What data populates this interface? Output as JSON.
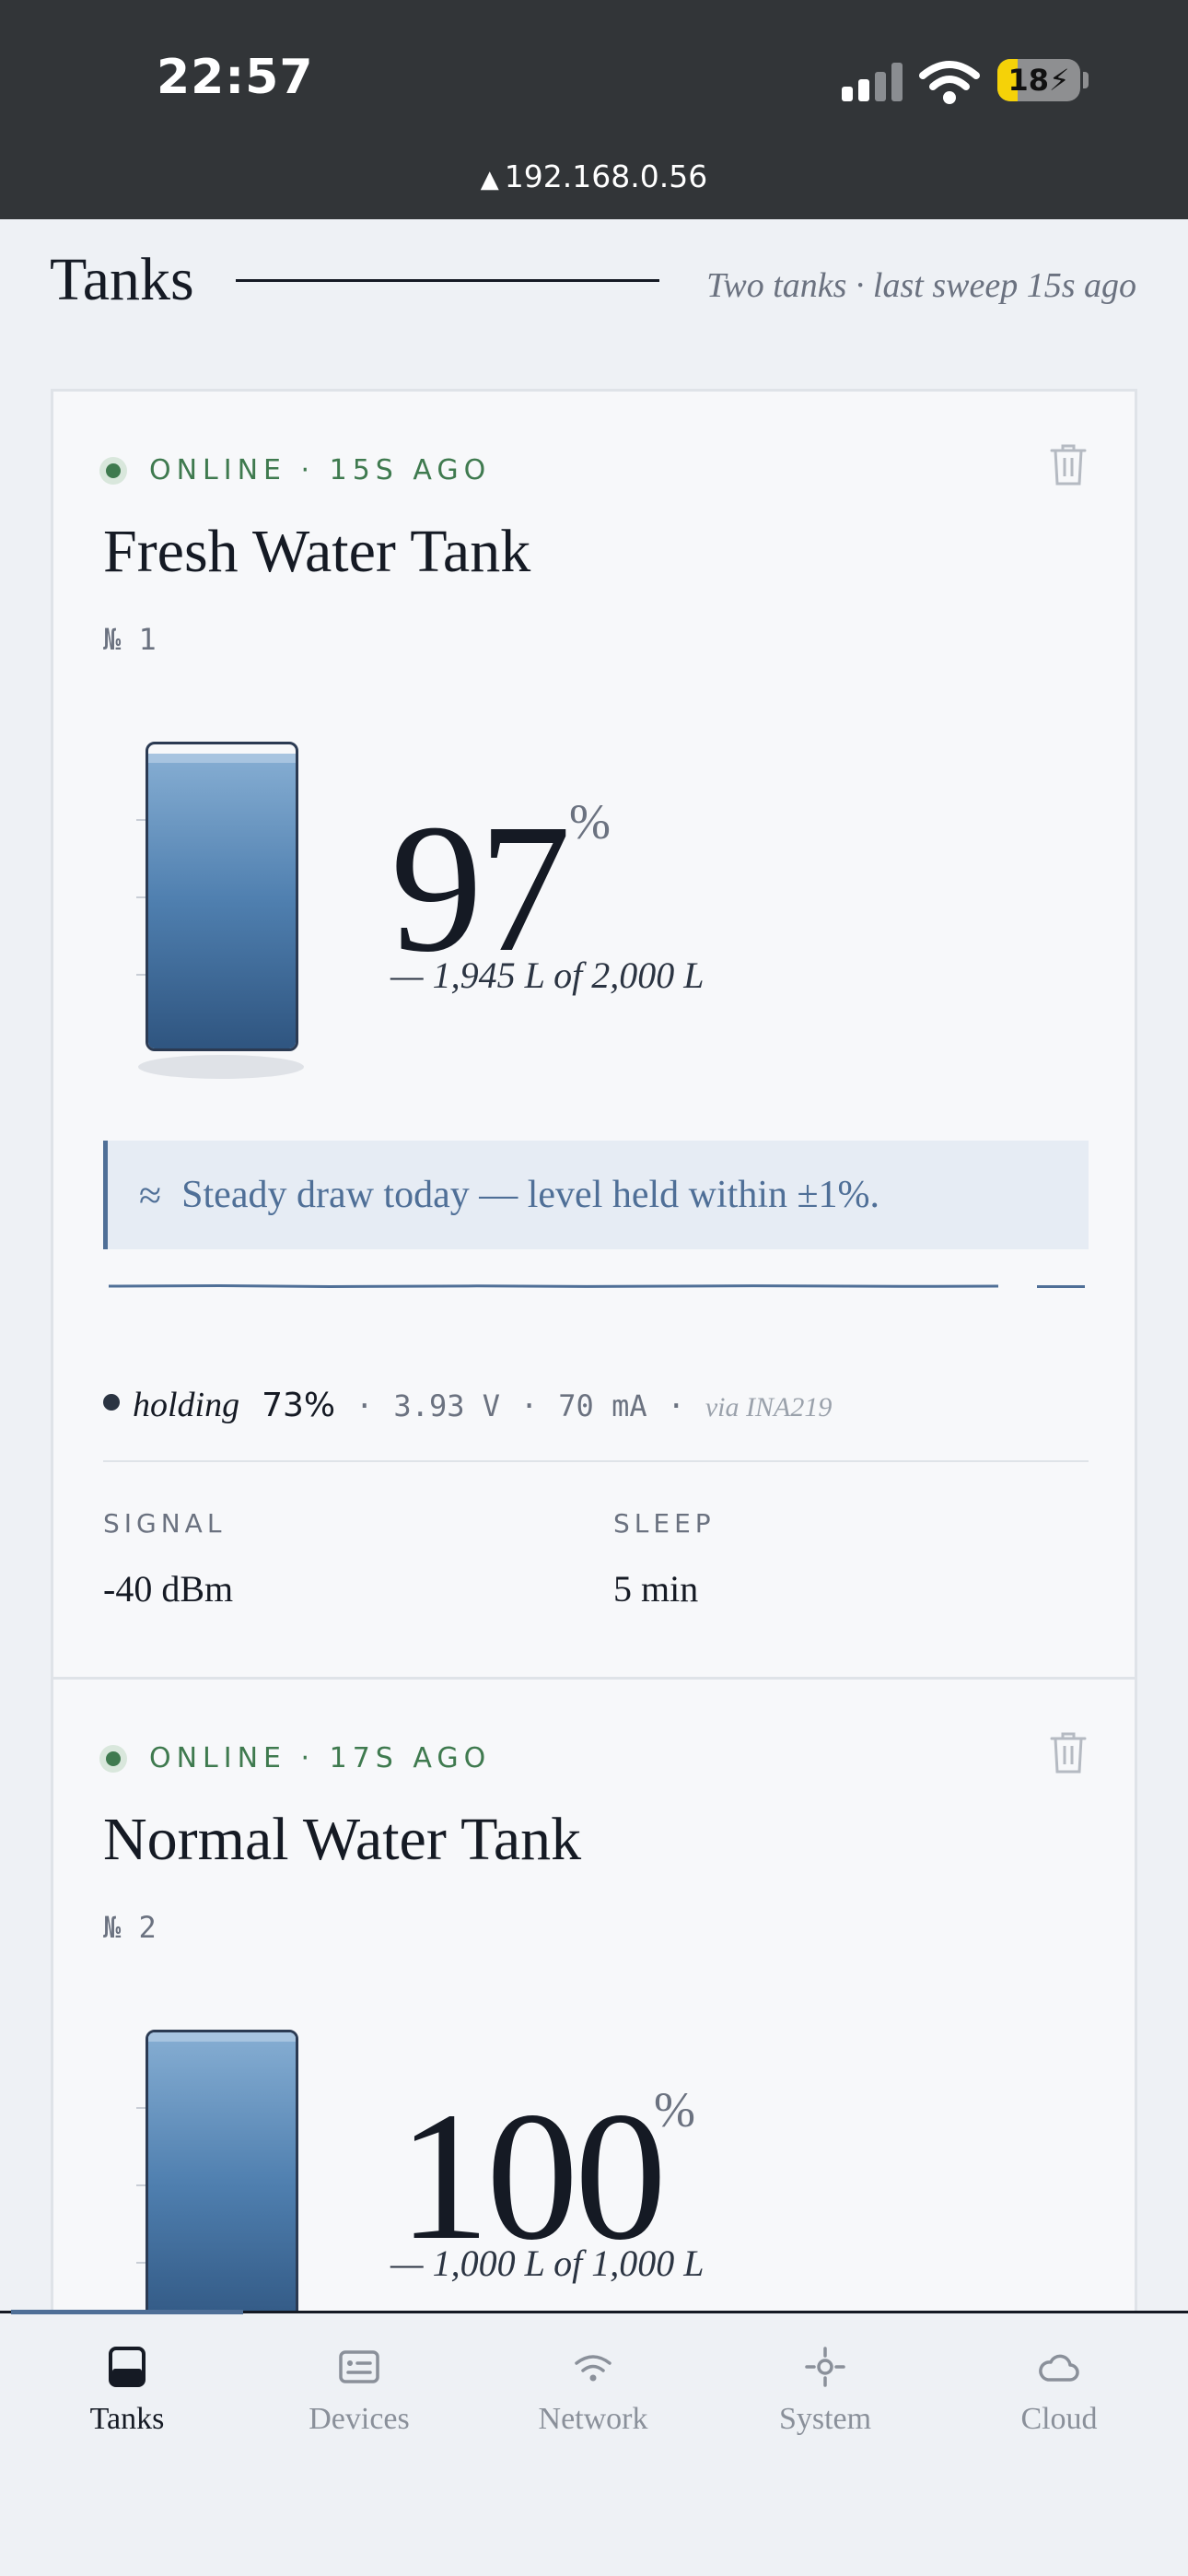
{
  "status_bar": {
    "time": "22:57",
    "battery": "18",
    "url": "192.168.0.56"
  },
  "header": {
    "title": "Tanks",
    "subtitle": "Two tanks · last sweep 15s ago"
  },
  "tanks": [
    {
      "status": "ONLINE · 15S AGO",
      "name": "Fresh Water Tank",
      "number": "№ 1",
      "percent": "97",
      "percent_sign": "%",
      "fill_fraction": 0.97,
      "volume": "— 1,945 L of 2,000 L",
      "note_icon": "≈",
      "note": "Steady draw today — level held within ±1%.",
      "battery_state": "holding",
      "battery_percent": "73%",
      "voltage": "3.93 V",
      "current": "70 mA",
      "sensor": "via INA219",
      "signal_label": "SIGNAL",
      "signal_value": "-40 dBm",
      "sleep_label": "SLEEP",
      "sleep_value": "5 min"
    },
    {
      "status": "ONLINE · 17S AGO",
      "name": "Normal Water Tank",
      "number": "№ 2",
      "percent": "100",
      "percent_sign": "%",
      "fill_fraction": 1.0,
      "volume": "— 1,000 L of 1,000 L"
    }
  ],
  "tabs": [
    {
      "label": "Tanks",
      "icon": "tank-icon",
      "active": true
    },
    {
      "label": "Devices",
      "icon": "devices-icon",
      "active": false
    },
    {
      "label": "Network",
      "icon": "wifi-icon",
      "active": false
    },
    {
      "label": "System",
      "icon": "system-icon",
      "active": false
    },
    {
      "label": "Cloud",
      "icon": "cloud-icon",
      "active": false
    }
  ],
  "colors": {
    "accent": "#4f6f97",
    "online": "#3f7a4f",
    "ink": "#151a24"
  }
}
